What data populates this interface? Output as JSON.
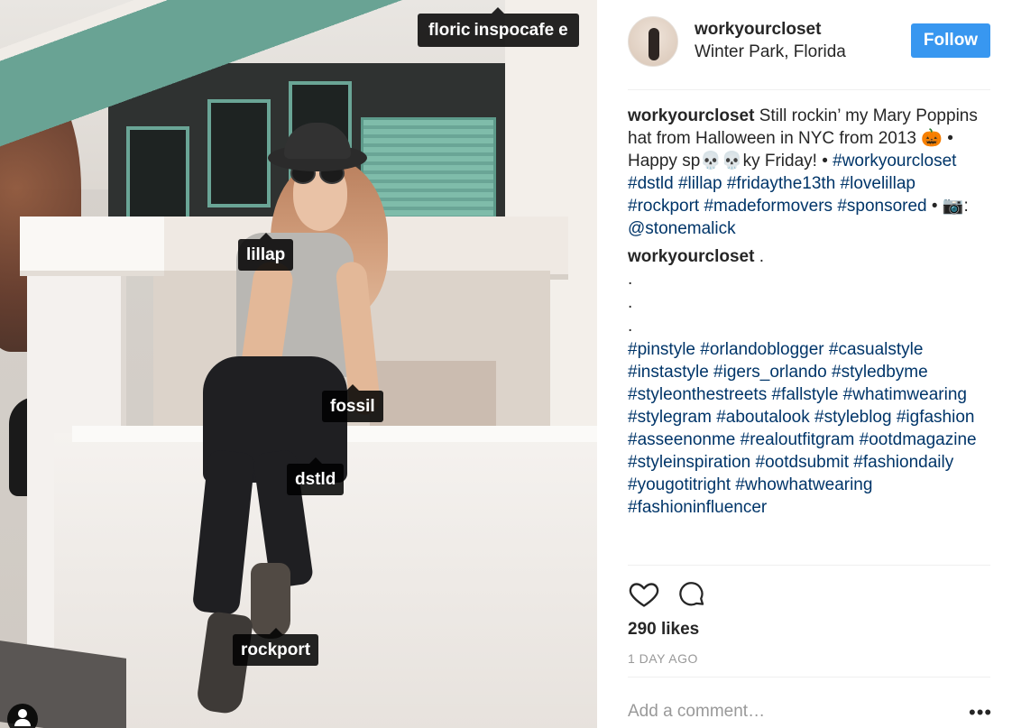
{
  "photo": {
    "tags": {
      "top_left": "floric",
      "top_right": "inspocafe",
      "top_suffix": "e",
      "lillap": "lillap",
      "fossil": "fossil",
      "dstld": "dstld",
      "rockport": "rockport"
    }
  },
  "header": {
    "username": "workyourcloset",
    "location": "Winter Park, Florida",
    "follow_label": "Follow"
  },
  "caption": {
    "author": "workyourcloset",
    "text": "Still rockin’ my Mary Poppins hat from Halloween in NYC from 2013 🎃 • Happy sp💀💀ky Friday! •",
    "hashtags": "#workyourcloset #dstld #lillap #fridaythe13th #lovelillap #rockport #madeformovers #sponsored",
    "photo_credit_prefix": "• 📷:",
    "photo_credit": "@stonemalick"
  },
  "comment": {
    "author": "workyourcloset",
    "text": ".",
    "dots": [
      ".",
      ".",
      "."
    ],
    "hashtags": "#pinstyle #orlandoblogger #casualstyle #instastyle #igers_orlando #styledbyme #styleonthestreets #fallstyle #whatimwearing #stylegram #aboutalook #styleblog #igfashion #asseenonme #realoutfitgram #ootdmagazine #styleinspiration #ootdsubmit #fashiondaily #yougotitright #whowhatwearing #fashioninfluencer"
  },
  "footer": {
    "likes": "290 likes",
    "timestamp": "1 DAY AGO",
    "comment_placeholder": "Add a comment…",
    "more": "•••"
  },
  "icons": [
    "heart-icon",
    "comment-icon",
    "user-tag-icon",
    "more-icon"
  ],
  "colors": {
    "follow": "#3897f0",
    "hashtag": "#003569",
    "tag_bg": "#000000"
  }
}
